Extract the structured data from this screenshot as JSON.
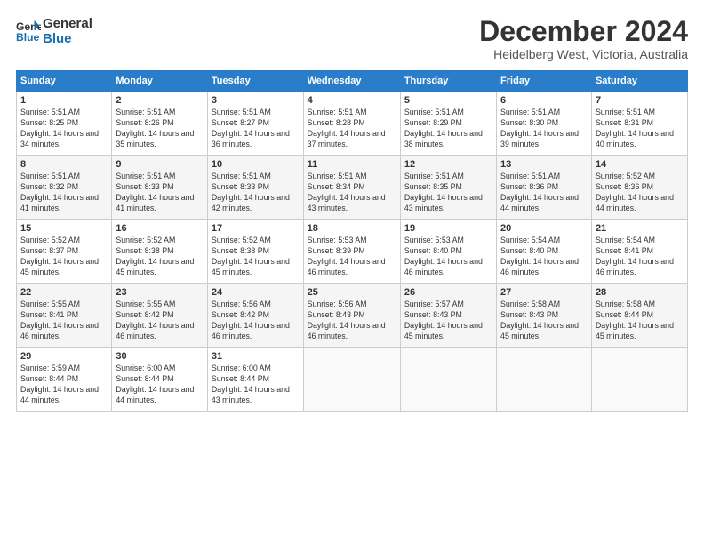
{
  "logo": {
    "line1": "General",
    "line2": "Blue"
  },
  "title": "December 2024",
  "subtitle": "Heidelberg West, Victoria, Australia",
  "headers": [
    "Sunday",
    "Monday",
    "Tuesday",
    "Wednesday",
    "Thursday",
    "Friday",
    "Saturday"
  ],
  "weeks": [
    [
      {
        "day": "1",
        "sunrise": "Sunrise: 5:51 AM",
        "sunset": "Sunset: 8:25 PM",
        "daylight": "Daylight: 14 hours and 34 minutes."
      },
      {
        "day": "2",
        "sunrise": "Sunrise: 5:51 AM",
        "sunset": "Sunset: 8:26 PM",
        "daylight": "Daylight: 14 hours and 35 minutes."
      },
      {
        "day": "3",
        "sunrise": "Sunrise: 5:51 AM",
        "sunset": "Sunset: 8:27 PM",
        "daylight": "Daylight: 14 hours and 36 minutes."
      },
      {
        "day": "4",
        "sunrise": "Sunrise: 5:51 AM",
        "sunset": "Sunset: 8:28 PM",
        "daylight": "Daylight: 14 hours and 37 minutes."
      },
      {
        "day": "5",
        "sunrise": "Sunrise: 5:51 AM",
        "sunset": "Sunset: 8:29 PM",
        "daylight": "Daylight: 14 hours and 38 minutes."
      },
      {
        "day": "6",
        "sunrise": "Sunrise: 5:51 AM",
        "sunset": "Sunset: 8:30 PM",
        "daylight": "Daylight: 14 hours and 39 minutes."
      },
      {
        "day": "7",
        "sunrise": "Sunrise: 5:51 AM",
        "sunset": "Sunset: 8:31 PM",
        "daylight": "Daylight: 14 hours and 40 minutes."
      }
    ],
    [
      {
        "day": "8",
        "sunrise": "Sunrise: 5:51 AM",
        "sunset": "Sunset: 8:32 PM",
        "daylight": "Daylight: 14 hours and 41 minutes."
      },
      {
        "day": "9",
        "sunrise": "Sunrise: 5:51 AM",
        "sunset": "Sunset: 8:33 PM",
        "daylight": "Daylight: 14 hours and 41 minutes."
      },
      {
        "day": "10",
        "sunrise": "Sunrise: 5:51 AM",
        "sunset": "Sunset: 8:33 PM",
        "daylight": "Daylight: 14 hours and 42 minutes."
      },
      {
        "day": "11",
        "sunrise": "Sunrise: 5:51 AM",
        "sunset": "Sunset: 8:34 PM",
        "daylight": "Daylight: 14 hours and 43 minutes."
      },
      {
        "day": "12",
        "sunrise": "Sunrise: 5:51 AM",
        "sunset": "Sunset: 8:35 PM",
        "daylight": "Daylight: 14 hours and 43 minutes."
      },
      {
        "day": "13",
        "sunrise": "Sunrise: 5:51 AM",
        "sunset": "Sunset: 8:36 PM",
        "daylight": "Daylight: 14 hours and 44 minutes."
      },
      {
        "day": "14",
        "sunrise": "Sunrise: 5:52 AM",
        "sunset": "Sunset: 8:36 PM",
        "daylight": "Daylight: 14 hours and 44 minutes."
      }
    ],
    [
      {
        "day": "15",
        "sunrise": "Sunrise: 5:52 AM",
        "sunset": "Sunset: 8:37 PM",
        "daylight": "Daylight: 14 hours and 45 minutes."
      },
      {
        "day": "16",
        "sunrise": "Sunrise: 5:52 AM",
        "sunset": "Sunset: 8:38 PM",
        "daylight": "Daylight: 14 hours and 45 minutes."
      },
      {
        "day": "17",
        "sunrise": "Sunrise: 5:52 AM",
        "sunset": "Sunset: 8:38 PM",
        "daylight": "Daylight: 14 hours and 45 minutes."
      },
      {
        "day": "18",
        "sunrise": "Sunrise: 5:53 AM",
        "sunset": "Sunset: 8:39 PM",
        "daylight": "Daylight: 14 hours and 46 minutes."
      },
      {
        "day": "19",
        "sunrise": "Sunrise: 5:53 AM",
        "sunset": "Sunset: 8:40 PM",
        "daylight": "Daylight: 14 hours and 46 minutes."
      },
      {
        "day": "20",
        "sunrise": "Sunrise: 5:54 AM",
        "sunset": "Sunset: 8:40 PM",
        "daylight": "Daylight: 14 hours and 46 minutes."
      },
      {
        "day": "21",
        "sunrise": "Sunrise: 5:54 AM",
        "sunset": "Sunset: 8:41 PM",
        "daylight": "Daylight: 14 hours and 46 minutes."
      }
    ],
    [
      {
        "day": "22",
        "sunrise": "Sunrise: 5:55 AM",
        "sunset": "Sunset: 8:41 PM",
        "daylight": "Daylight: 14 hours and 46 minutes."
      },
      {
        "day": "23",
        "sunrise": "Sunrise: 5:55 AM",
        "sunset": "Sunset: 8:42 PM",
        "daylight": "Daylight: 14 hours and 46 minutes."
      },
      {
        "day": "24",
        "sunrise": "Sunrise: 5:56 AM",
        "sunset": "Sunset: 8:42 PM",
        "daylight": "Daylight: 14 hours and 46 minutes."
      },
      {
        "day": "25",
        "sunrise": "Sunrise: 5:56 AM",
        "sunset": "Sunset: 8:43 PM",
        "daylight": "Daylight: 14 hours and 46 minutes."
      },
      {
        "day": "26",
        "sunrise": "Sunrise: 5:57 AM",
        "sunset": "Sunset: 8:43 PM",
        "daylight": "Daylight: 14 hours and 45 minutes."
      },
      {
        "day": "27",
        "sunrise": "Sunrise: 5:58 AM",
        "sunset": "Sunset: 8:43 PM",
        "daylight": "Daylight: 14 hours and 45 minutes."
      },
      {
        "day": "28",
        "sunrise": "Sunrise: 5:58 AM",
        "sunset": "Sunset: 8:44 PM",
        "daylight": "Daylight: 14 hours and 45 minutes."
      }
    ],
    [
      {
        "day": "29",
        "sunrise": "Sunrise: 5:59 AM",
        "sunset": "Sunset: 8:44 PM",
        "daylight": "Daylight: 14 hours and 44 minutes."
      },
      {
        "day": "30",
        "sunrise": "Sunrise: 6:00 AM",
        "sunset": "Sunset: 8:44 PM",
        "daylight": "Daylight: 14 hours and 44 minutes."
      },
      {
        "day": "31",
        "sunrise": "Sunrise: 6:00 AM",
        "sunset": "Sunset: 8:44 PM",
        "daylight": "Daylight: 14 hours and 43 minutes."
      },
      null,
      null,
      null,
      null
    ]
  ]
}
